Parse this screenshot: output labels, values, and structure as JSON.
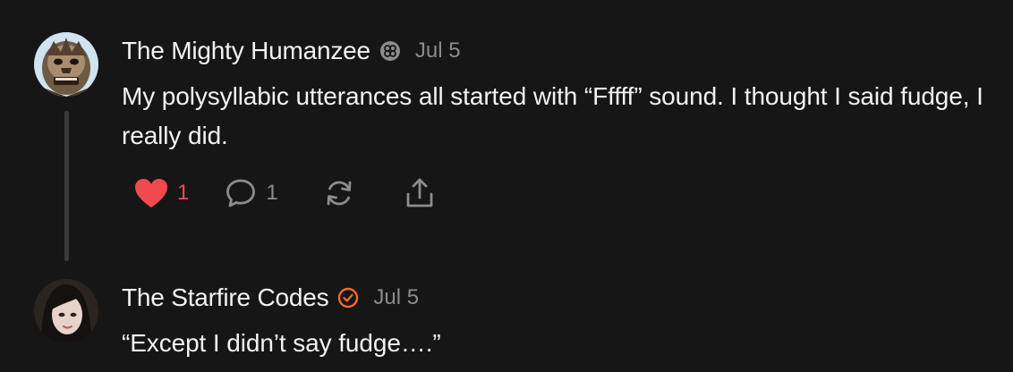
{
  "comments": [
    {
      "author": "The Mighty Humanzee",
      "badge_icon": "subscriber-badge-icon",
      "date": "Jul 5",
      "text": "My polysyllabic utterances all started with “Fffff” sound. I thought I said fudge, I really did.",
      "actions": {
        "like_count": "1",
        "reply_count": "1"
      }
    },
    {
      "author": "The Starfire Codes",
      "badge_icon": "verified-check-icon",
      "date": "Jul 5",
      "text": "“Except I didn’t say fudge….”"
    }
  ],
  "colors": {
    "background": "#161616",
    "text": "#f2f2f2",
    "muted": "#8c8c8c",
    "like": "#f04a4f",
    "verified": "#f26b2c",
    "thread_line": "#3a3a3a"
  }
}
